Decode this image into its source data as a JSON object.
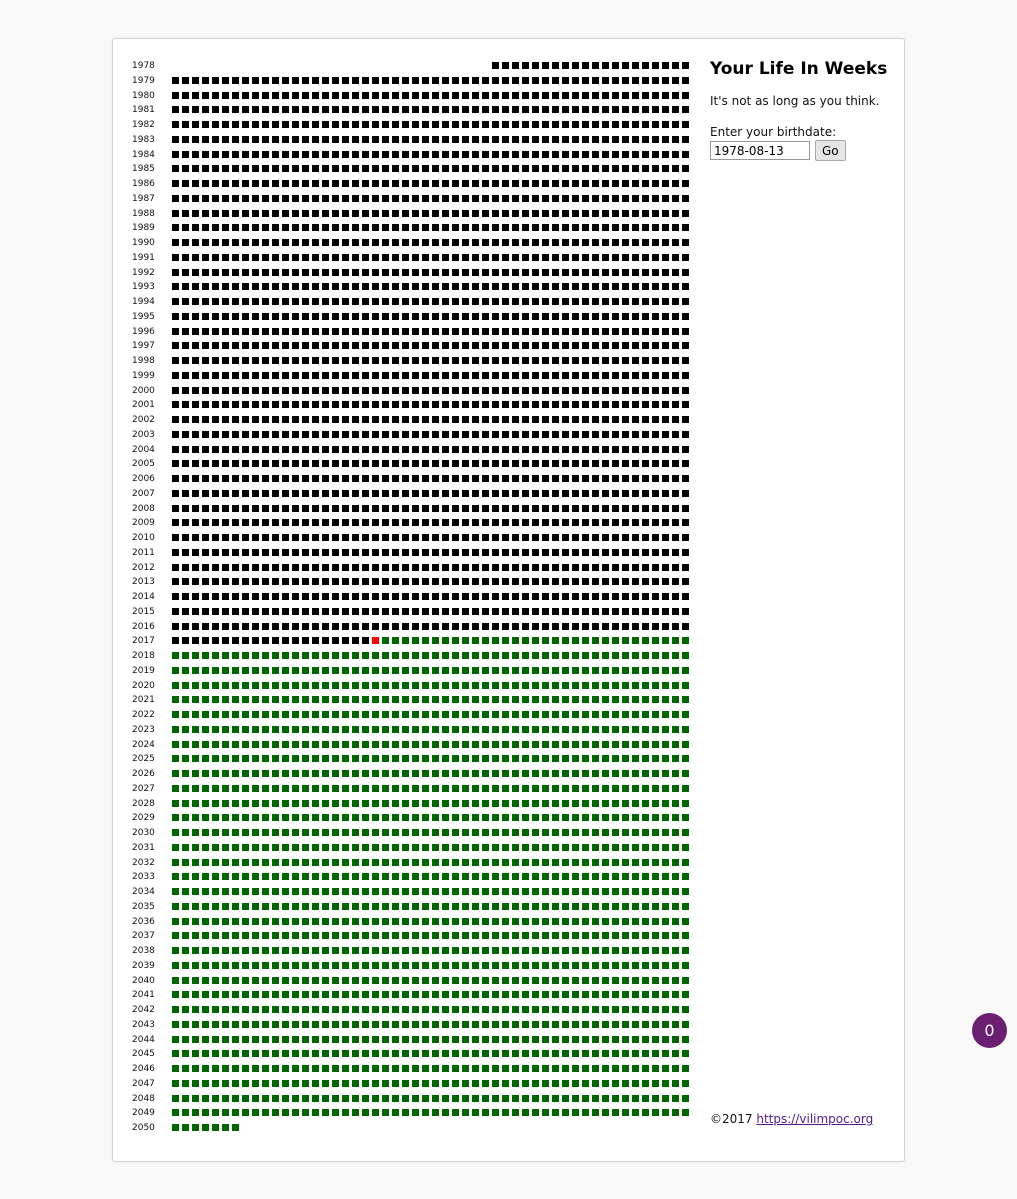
{
  "page": {
    "title": "Your Life In Weeks",
    "tagline": "It's not as long as you think.",
    "birthdate_prompt": "Enter your birthdate:",
    "birthdate_value": "1978-08-13",
    "go_label": "Go",
    "footer_copyright": "©2017",
    "footer_link_text": "https://vilimpoc.org",
    "badge_count": "0"
  },
  "grid": {
    "weeks_per_year": 52,
    "first_year": 1978,
    "last_year": 2050,
    "birth_week_index": 32,
    "current_year": 2017,
    "current_week_index": 20,
    "final_year_weeks": 8,
    "colors": {
      "lived": "#000000",
      "current": "#ff0000",
      "remaining": "#006600"
    }
  }
}
